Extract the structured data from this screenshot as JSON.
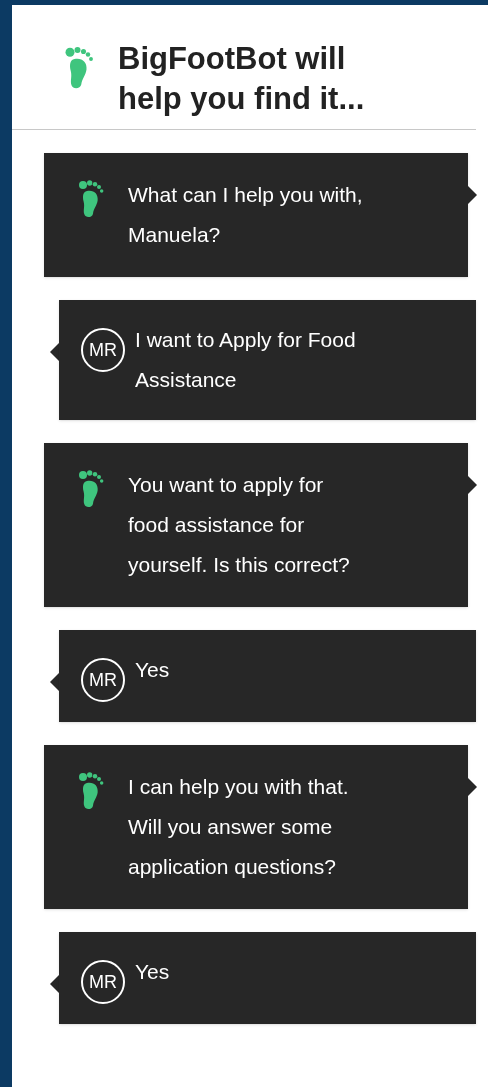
{
  "header": {
    "title": "BigFootBot will\nhelp you find it..."
  },
  "messages": [
    {
      "kind": "bot",
      "text": "What can I help you with,\nManuela?"
    },
    {
      "kind": "user",
      "initials": "MR",
      "text": "I want to Apply for Food\nAssistance"
    },
    {
      "kind": "bot",
      "text": "You want to apply for\nfood assistance for\nyourself. Is this correct?"
    },
    {
      "kind": "user",
      "initials": "MR",
      "text": "Yes"
    },
    {
      "kind": "bot",
      "text": "I can help you with that.\nWill you answer some\napplication questions?"
    },
    {
      "kind": "user",
      "initials": "MR",
      "text": "Yes"
    }
  ]
}
